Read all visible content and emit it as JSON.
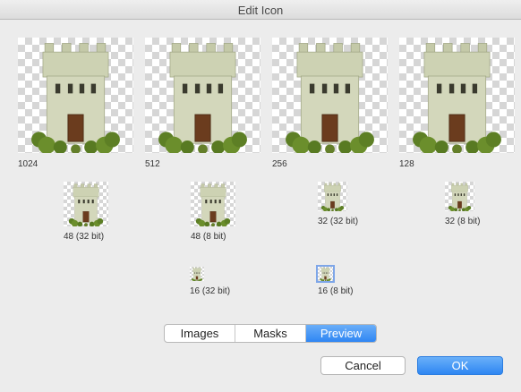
{
  "window": {
    "title": "Edit Icon"
  },
  "icons": [
    {
      "label": "1024"
    },
    {
      "label": "512"
    },
    {
      "label": "256"
    },
    {
      "label": "128"
    },
    {
      "label": "48 (32 bit)"
    },
    {
      "label": "48 (8 bit)"
    },
    {
      "label": "32 (32 bit)"
    },
    {
      "label": "32 (8 bit)"
    },
    {
      "label": "16 (32 bit)"
    },
    {
      "label": "16 (8 bit)"
    }
  ],
  "tabs": [
    {
      "label": "Images",
      "active": false
    },
    {
      "label": "Masks",
      "active": false
    },
    {
      "label": "Preview",
      "active": true
    }
  ],
  "buttons": {
    "cancel": "Cancel",
    "ok": "OK"
  },
  "colors": {
    "accent": "#2f86f3",
    "tower_stone": "#c9cfb0",
    "door": "#6b3c1e",
    "bush": "#5d7f25"
  }
}
